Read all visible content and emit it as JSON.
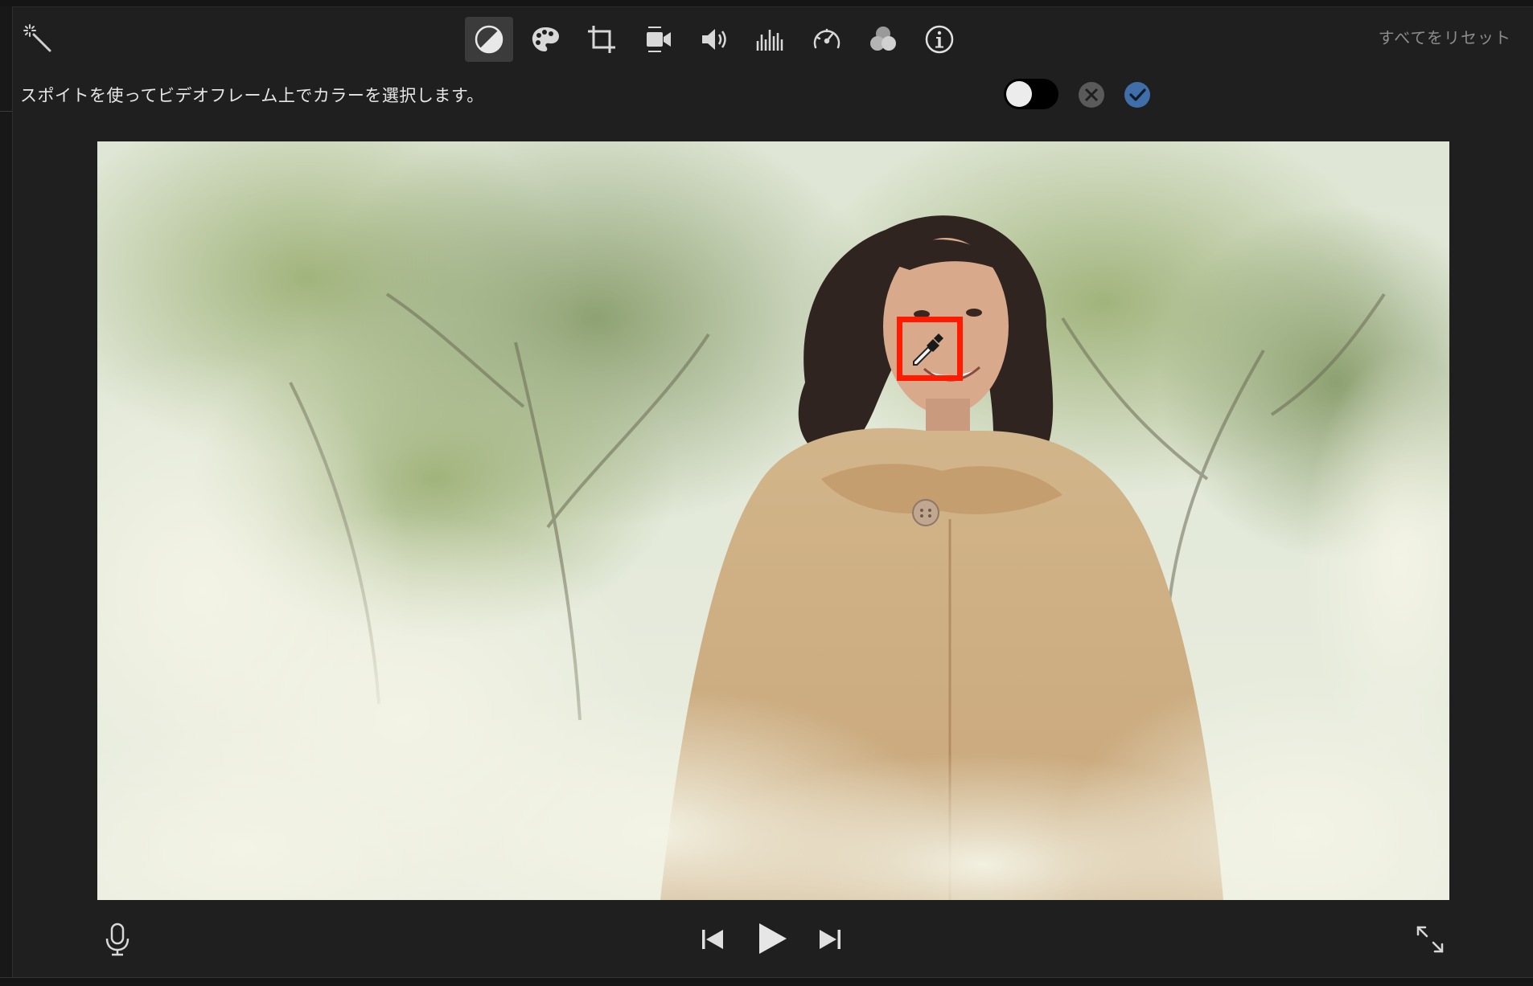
{
  "toolbar": {
    "magic_wand_icon": "magic-wand",
    "tools": [
      {
        "name": "color-balance",
        "icon": "half-circle-icon",
        "active": true
      },
      {
        "name": "color-correction",
        "icon": "palette-icon",
        "active": false
      },
      {
        "name": "crop",
        "icon": "crop-icon",
        "active": false
      },
      {
        "name": "stabilization",
        "icon": "video-camera-icon",
        "active": false
      },
      {
        "name": "volume",
        "icon": "speaker-icon",
        "active": false
      },
      {
        "name": "noise-reduction-equalizer",
        "icon": "equalizer-icon",
        "active": false
      },
      {
        "name": "speed",
        "icon": "speedometer-icon",
        "active": false
      },
      {
        "name": "clip-filter",
        "icon": "overlapping-circles-icon",
        "active": false
      },
      {
        "name": "clip-info",
        "icon": "info-icon",
        "active": false
      }
    ],
    "reset_all_label": "すべてをリセット"
  },
  "instruction": {
    "text": "スポイトを使ってビデオフレーム上でカラーを選択します。",
    "toggle_on": false
  },
  "colors": {
    "accent_blue": "#3f6ea8",
    "highlight_red": "#ff1a00"
  },
  "viewer": {
    "content": "video-frame",
    "eyedropper_icon": "eyedropper-icon"
  },
  "playback": {
    "mic_icon": "microphone-icon",
    "prev_icon": "skip-back-icon",
    "play_icon": "play-icon",
    "next_icon": "skip-forward-icon",
    "fullscreen_icon": "expand-icon"
  }
}
